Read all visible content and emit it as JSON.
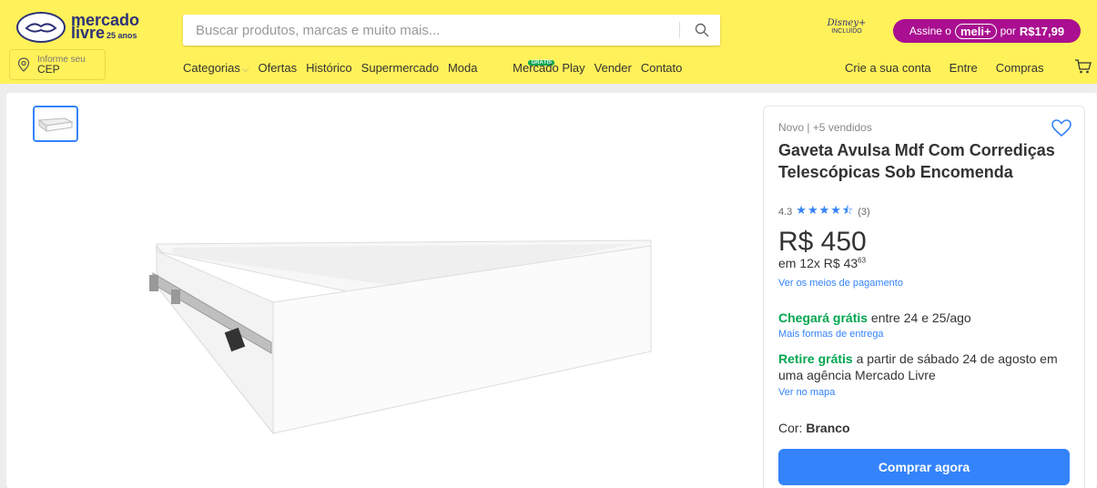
{
  "header": {
    "logo": {
      "line1": "mercado",
      "line2": "livre",
      "tag": "25 anos"
    },
    "search": {
      "placeholder": "Buscar produtos, marcas e muito mais..."
    },
    "disney": {
      "brand": "Disney+",
      "sub": "INCLUÍDO"
    },
    "subscription": {
      "prefix": "Assine o",
      "brand": "meli+",
      "mid": "por",
      "price": "R$17,99"
    },
    "cep": {
      "line1": "Informe seu",
      "line2": "CEP"
    },
    "nav": [
      {
        "label": "Categorias"
      },
      {
        "label": "Ofertas"
      },
      {
        "label": "Histórico"
      },
      {
        "label": "Supermercado"
      },
      {
        "label": "Moda"
      },
      {
        "label": "Mercado Play",
        "badge": "GRÁTIS"
      },
      {
        "label": "Vender"
      },
      {
        "label": "Contato"
      }
    ],
    "right_nav": [
      {
        "label": "Crie a sua conta"
      },
      {
        "label": "Entre"
      },
      {
        "label": "Compras"
      }
    ]
  },
  "product": {
    "condition": "Novo  |  +5 vendidos",
    "title": "Gaveta Avulsa Mdf Com Corrediças Telescópicas Sob Encomenda",
    "rating_value": "4.3",
    "rating_stars": "★★★★⯪",
    "rating_count": "(3)",
    "price": "R$ 450",
    "installments_prefix": "em 12x R$ 43",
    "installments_cents": "63",
    "payment_link": "Ver os meios de pagamento",
    "shipping_green": "Chegará grátis",
    "shipping_rest": " entre 24 e 25/ago",
    "shipping_link": "Mais formas de entrega",
    "pickup_green": "Retire grátis",
    "pickup_rest": " a partir de sábado 24 de agosto em uma agência Mercado Livre",
    "map_link": "Ver no mapa",
    "color_label": "Cor: ",
    "color_value": "Branco",
    "buy_label": "Comprar agora"
  },
  "colors": {
    "header": "#fff159",
    "accent": "#3483fa",
    "green": "#00a650",
    "meli": "#a90f90"
  }
}
